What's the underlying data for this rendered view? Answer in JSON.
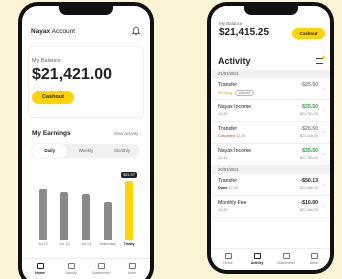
{
  "left_phone": {
    "header": {
      "brand": "Nayax",
      "suffix": "Account"
    },
    "balance": {
      "label": "My Balance",
      "value": "$21,421.00",
      "cashout_label": "Cashout"
    },
    "earnings": {
      "title": "My Earnings",
      "view_activity_label": "View activity",
      "tabs": [
        "Daily",
        "Weekly",
        "Monthly"
      ],
      "active_tab": "Daily",
      "tooltip": "$31.97"
    },
    "chart_data": {
      "type": "bar",
      "categories": [
        "Jul 12",
        "Jul 13",
        "Jul 14",
        "Yesterday",
        "Today"
      ],
      "values": [
        0.82,
        0.78,
        0.74,
        0.62,
        0.95
      ],
      "highlight_index": 4,
      "colors": {
        "bar": "#8A8A8A",
        "highlight": "#FFD400"
      }
    },
    "nav": [
      {
        "label": "Home",
        "icon": "home-icon"
      },
      {
        "label": "Activity",
        "icon": "activity-icon"
      },
      {
        "label": "Statements",
        "icon": "statements-icon"
      },
      {
        "label": "More",
        "icon": "more-icon"
      }
    ],
    "active_nav": "Home"
  },
  "right_phone": {
    "balance": {
      "label": "My Balance",
      "value": "$21,415.25",
      "cashout_label": "Cashout"
    },
    "activity_title": "Activity",
    "groups": [
      {
        "date": "21/03/2021",
        "rows": [
          {
            "title": "Transfer",
            "status": "Pending",
            "chip": "Cancel",
            "amount": "-$25.50",
            "balance": "",
            "amount_style": "gray"
          },
          {
            "title": "Nayax Income",
            "time": "12:45",
            "amount": "$35.50",
            "balance": "$21,781.20",
            "amount_style": "pos"
          },
          {
            "title": "Transfer",
            "status": "Cancelled",
            "time": "12:45",
            "amount": "-$25.50",
            "balance": "$21,415.25",
            "amount_style": "gray"
          },
          {
            "title": "Nayax Income",
            "time": "12:45",
            "amount": "$35.50",
            "balance": "$21,781.20",
            "amount_style": "pos"
          }
        ]
      },
      {
        "date": "20/03/2021",
        "rows": [
          {
            "title": "Transfer",
            "status": "Done",
            "time": "12:45",
            "amount": "-$50.13",
            "balance": "$21,456.20",
            "amount_style": "neg"
          },
          {
            "title": "Monthly Fee",
            "time": "12:45",
            "amount": "-$10.00",
            "balance": "$21,456.20",
            "amount_style": "neg"
          }
        ]
      }
    ],
    "nav": [
      {
        "label": "Home",
        "icon": "home-icon"
      },
      {
        "label": "Activity",
        "icon": "activity-icon"
      },
      {
        "label": "Statements",
        "icon": "statements-icon"
      },
      {
        "label": "More",
        "icon": "more-icon"
      }
    ],
    "active_nav": "Activity"
  }
}
